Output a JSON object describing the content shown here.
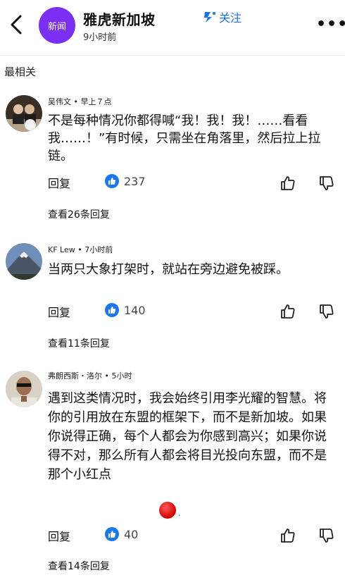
{
  "header": {
    "logo_text": "新闻",
    "channel_name": "雅虎新加坡",
    "time": "9小时前",
    "follow_label": "关注",
    "more_label": "•••"
  },
  "sort_label": "最相关",
  "comments": [
    {
      "author": "吴伟文",
      "time": "早上７点",
      "text": "不是每种情况你都得喊“我！我！我！……看看我……！”有时候，只需坐在角落里，然后拉上拉链。",
      "reply_label": "回复",
      "likes": "237",
      "view_replies": "查看26条回复"
    },
    {
      "author": "KF Lew",
      "time": "7小时前",
      "text": "当两只大象打架时，就站在旁边避免被踩。",
      "reply_label": "回复",
      "likes": "140",
      "view_replies": "查看11条回复"
    },
    {
      "author": "弗朗西斯・洛尔",
      "time": "5小时",
      "text": "遇到这类情况时，我会始终引用李光耀的智慧。将你的引用放在东盟的框架下，而不是新加坡。如果你说得正确，每个人都会为你感到高兴；如果你说得不对，那么所有人都会将目光投向东盟，而不是那个小红点",
      "reply_label": "回复",
      "likes": "40",
      "view_replies": "查看14条回复"
    }
  ],
  "colors": {
    "logo_bg": "#7b2ff2",
    "follow": "#1a73e8",
    "like_bubble": "#1877f2",
    "red_dot": "#d00000"
  }
}
